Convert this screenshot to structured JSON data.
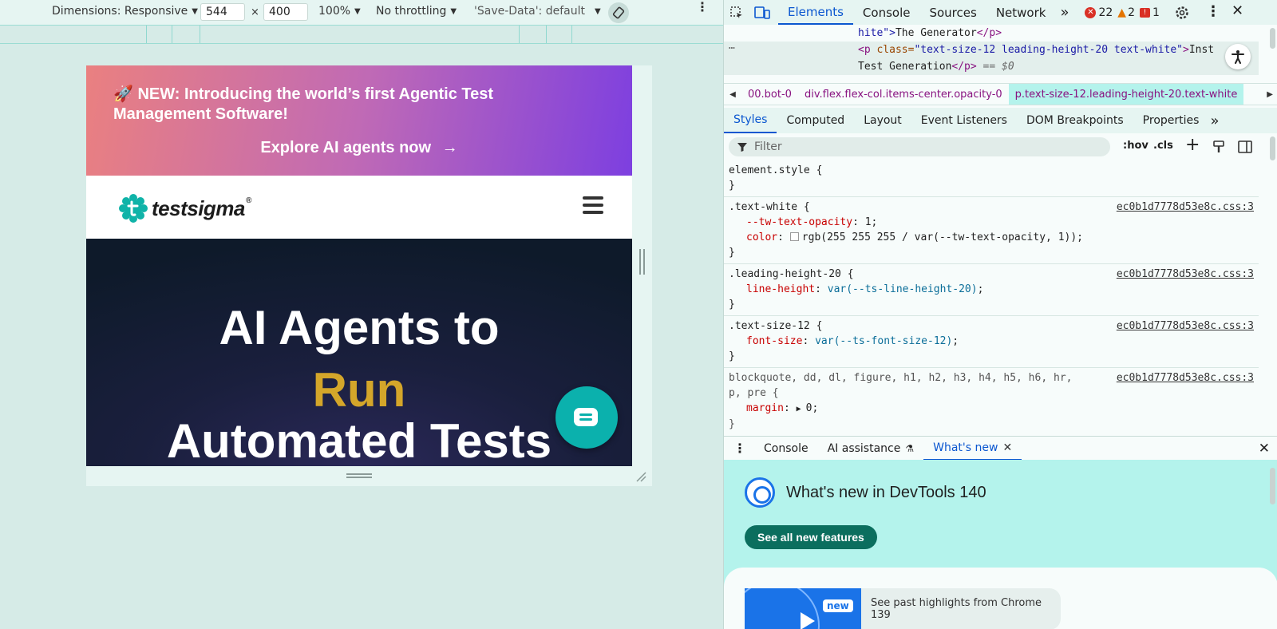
{
  "device_toolbar": {
    "dimensions_label": "Dimensions: Responsive",
    "width": "544",
    "times": "×",
    "height": "400",
    "zoom": "100%",
    "throttling": "No throttling",
    "save_data": "'Save-Data': default"
  },
  "page": {
    "banner": {
      "emoji": "🚀",
      "text": "NEW: Introducing the world’s first Agentic Test Management Software!",
      "cta": "Explore AI agents now",
      "cta_arrow": "→"
    },
    "logo": {
      "text": "testsigma",
      "reg": "®"
    },
    "hero": {
      "line1": "AI Agents to",
      "line2": "Run",
      "line3": "Automated Tests"
    }
  },
  "devtools": {
    "tabs": [
      "Elements",
      "Console",
      "Sources",
      "Network"
    ],
    "more_tabs": "»",
    "badges": {
      "errors": "22",
      "warnings": "2",
      "issues": "1"
    },
    "elements_lines": {
      "line1_attr": "hite\">",
      "line1_text": "The Generator",
      "line1_close": "</p>",
      "line2_open": "<p ",
      "line2_attr_name": "class=",
      "line2_attr_value": "\"text-size-12 leading-height-20 text-white\"",
      "line2_gt": ">",
      "line2_text": "Inst",
      "line3_text": "Test Generation",
      "line3_close": "</p>",
      "line3_eq": " == $0",
      "dots": "…"
    },
    "breadcrumbs": [
      "00.bot-0",
      "div.flex.flex-col.items-center.opacity-0",
      "p.text-size-12.leading-height-20.text-white"
    ],
    "subtabs": [
      "Styles",
      "Computed",
      "Layout",
      "Event Listeners",
      "DOM Breakpoints",
      "Properties"
    ],
    "filter_placeholder": "Filter",
    "filter_tools": {
      "hov": ":hov",
      "cls": ".cls",
      "plus": "+"
    },
    "styles": {
      "element_style": "element.style {",
      "close": "}",
      "source": "ec0b1d7778d53e8c.css:3",
      "rule1_selector": ".text-white {",
      "rule1_p1_name": "--tw-text-opacity",
      "rule1_p1_value": "1",
      "rule1_p2_name": "color",
      "rule1_p2_value": "rgb(255 255 255 / var(--tw-text-opacity, 1))",
      "rule2_selector": ".leading-height-20 {",
      "rule2_p1_name": "line-height",
      "rule2_p1_value": "var(--ts-line-height-20)",
      "rule3_selector": ".text-size-12 {",
      "rule3_p1_name": "font-size",
      "rule3_p1_value": "var(--ts-font-size-12)",
      "rule4_selector_a": "blockquote, dd, dl, figure, h1, h2, h3, h4, h5, h6, hr,",
      "rule4_selector_b": "p, pre {",
      "rule4_p1_name": "margin",
      "rule4_p1_value": "0"
    },
    "drawer": {
      "tabs": [
        "Console",
        "AI assistance",
        "What's new"
      ],
      "title": "What's new in DevTools 140",
      "button": "See all new features",
      "new_badge": "new",
      "highlights": "See past highlights from Chrome 139"
    }
  },
  "colors": {
    "accent": "#0b57d0",
    "hero_highlight": "#d4a62a",
    "chat": "#0bb1ad"
  }
}
